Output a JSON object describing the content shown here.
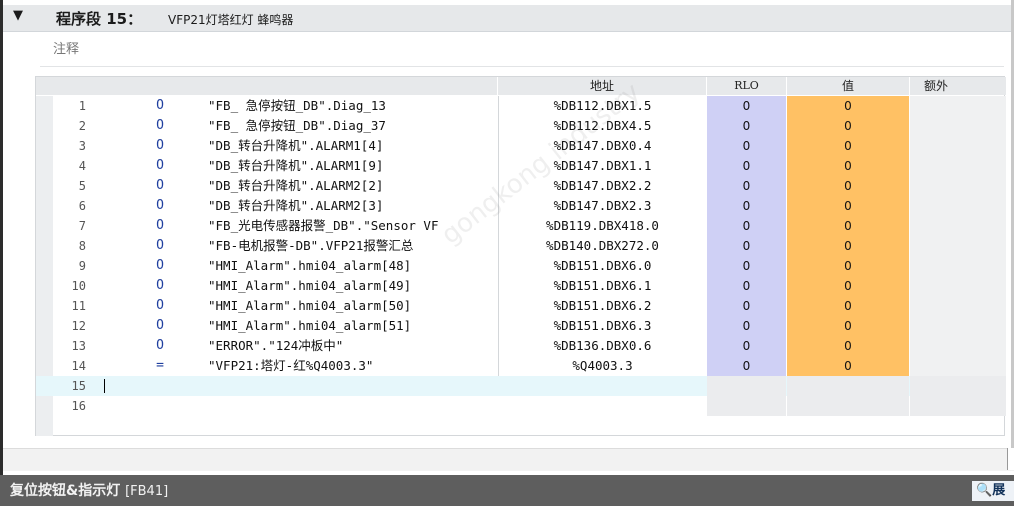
{
  "segment": {
    "collapse_icon": "triangle-down-icon",
    "label": "程序段 15：",
    "title": "VFP21灯塔红灯 蜂鸣器",
    "comment_placeholder": "注释"
  },
  "table": {
    "headers": {
      "address": "地址",
      "rlo": "RLO",
      "value": "值",
      "extra": "额外"
    },
    "rows": [
      {
        "num": "1",
        "op": "O",
        "operand": "\"FB_ 急停按钮_DB\".Diag_13",
        "address": "%DB112.DBX1.5",
        "rlo": "0",
        "value": "0"
      },
      {
        "num": "2",
        "op": "O",
        "operand": "\"FB_ 急停按钮_DB\".Diag_37",
        "address": "%DB112.DBX4.5",
        "rlo": "0",
        "value": "0"
      },
      {
        "num": "3",
        "op": "O",
        "operand": "\"DB_转台升降机\".ALARM1[4]",
        "address": "%DB147.DBX0.4",
        "rlo": "0",
        "value": "0"
      },
      {
        "num": "4",
        "op": "O",
        "operand": "\"DB_转台升降机\".ALARM1[9]",
        "address": "%DB147.DBX1.1",
        "rlo": "0",
        "value": "0"
      },
      {
        "num": "5",
        "op": "O",
        "operand": "\"DB_转台升降机\".ALARM2[2]",
        "address": "%DB147.DBX2.2",
        "rlo": "0",
        "value": "0"
      },
      {
        "num": "6",
        "op": "O",
        "operand": "\"DB_转台升降机\".ALARM2[3]",
        "address": "%DB147.DBX2.3",
        "rlo": "0",
        "value": "0"
      },
      {
        "num": "7",
        "op": "O",
        "operand": "\"FB_光电传感器报警_DB\".\"Sensor VF",
        "address": "%DB119.DBX418.0",
        "rlo": "0",
        "value": "0"
      },
      {
        "num": "8",
        "op": "O",
        "operand": "\"FB-电机报警-DB\".VFP21报警汇总",
        "address": "%DB140.DBX272.0",
        "rlo": "0",
        "value": "0"
      },
      {
        "num": "9",
        "op": "O",
        "operand": "\"HMI_Alarm\".hmi04_alarm[48]",
        "address": "%DB151.DBX6.0",
        "rlo": "0",
        "value": "0"
      },
      {
        "num": "10",
        "op": "O",
        "operand": "\"HMI_Alarm\".hmi04_alarm[49]",
        "address": "%DB151.DBX6.1",
        "rlo": "0",
        "value": "0"
      },
      {
        "num": "11",
        "op": "O",
        "operand": "\"HMI_Alarm\".hmi04_alarm[50]",
        "address": "%DB151.DBX6.2",
        "rlo": "0",
        "value": "0"
      },
      {
        "num": "12",
        "op": "O",
        "operand": "\"HMI_Alarm\".hmi04_alarm[51]",
        "address": "%DB151.DBX6.3",
        "rlo": "0",
        "value": "0"
      },
      {
        "num": "13",
        "op": "O",
        "operand": "\"ERROR\".\"124冲板中\"",
        "address": "%DB136.DBX0.6",
        "rlo": "0",
        "value": "0"
      },
      {
        "num": "14",
        "op": "=",
        "operand": "\"VFP21:塔灯-红%Q4003.3\"",
        "address": "%Q4003.3",
        "rlo": "0",
        "value": "0"
      },
      {
        "num": "15",
        "op": "",
        "operand": "",
        "address": "",
        "rlo": "",
        "value": ""
      },
      {
        "num": "16",
        "op": "",
        "operand": "",
        "address": "",
        "rlo": "",
        "value": ""
      }
    ]
  },
  "watermark": "gongkong industry",
  "footer": {
    "title": "复位按钮&指示灯",
    "tag": "[FB41]",
    "button_label": "展"
  },
  "colors": {
    "rlo": "#cfd0f5",
    "value": "#ffc164",
    "footer": "#5e5e5e"
  }
}
